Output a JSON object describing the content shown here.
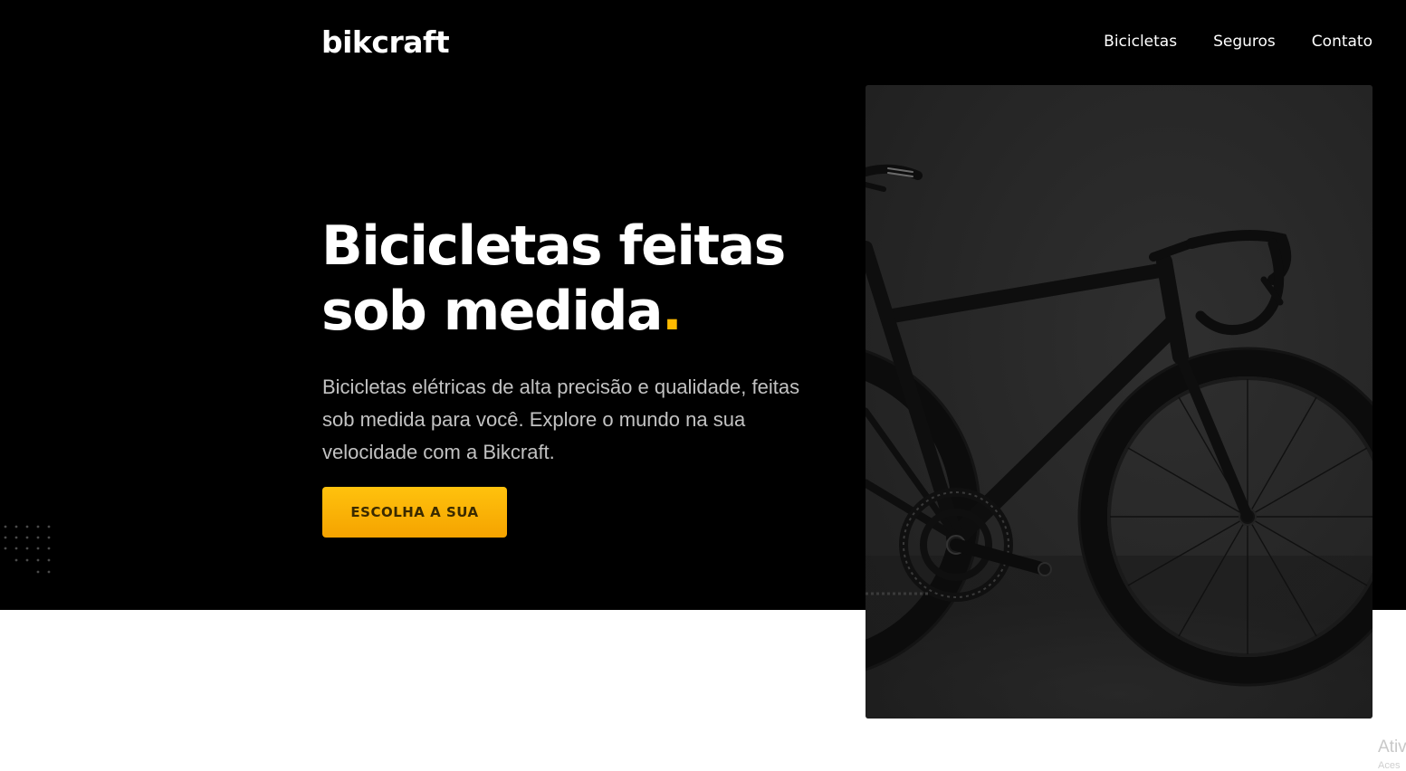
{
  "header": {
    "logo": "bikcraft",
    "nav": [
      {
        "label": "Bicicletas"
      },
      {
        "label": "Seguros"
      },
      {
        "label": "Contato"
      }
    ]
  },
  "hero": {
    "title_line1": "Bicicletas feitas",
    "title_line2": "sob medida",
    "title_dot": ".",
    "description": "Bicicletas elétricas de alta precisão e qualidade, feitas sob medida para você. Explore o mundo na sua velocidade com a Bikcraft.",
    "cta_label": "ESCOLHA A SUA",
    "image_alt": "Bicicleta preta"
  },
  "os_overlay": {
    "line1": "Ativ",
    "line2": "Aces"
  },
  "colors": {
    "accent": "#ffbb00",
    "background_dark": "#000000",
    "text_light": "#ffffff"
  }
}
